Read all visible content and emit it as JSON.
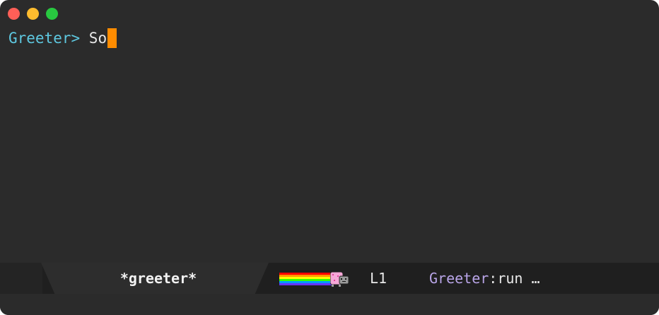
{
  "window": {
    "controls": [
      "close",
      "minimize",
      "zoom"
    ],
    "colors": {
      "close": "#ff5f57",
      "minimize": "#febc2e",
      "zoom": "#28c840"
    }
  },
  "terminal": {
    "prompt": "Greeter> ",
    "input": "So",
    "cursor_color": "#ff8c00"
  },
  "modeline": {
    "buffer_name": "*greeter*",
    "position_indicator": "nyan-cat",
    "line_number": "L1",
    "major_mode": "Greeter",
    "mode_suffix": ":run …"
  }
}
